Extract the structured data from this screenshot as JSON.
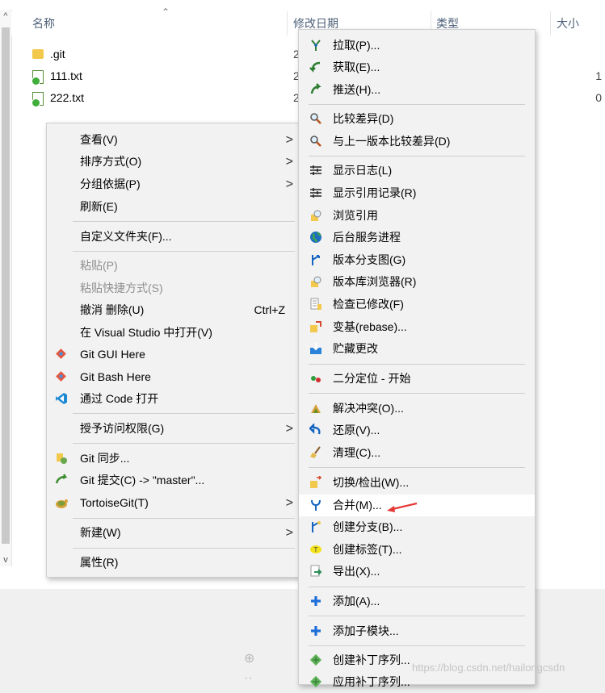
{
  "columns": {
    "name": "名称",
    "date": "修改日期",
    "type": "类型",
    "size": "大小"
  },
  "files": [
    {
      "name": ".git",
      "icon": "folder-icon",
      "date_frag": "2"
    },
    {
      "name": "111.txt",
      "icon": "git-file-icon",
      "date_frag": "2",
      "size_frag": "1"
    },
    {
      "name": "222.txt",
      "icon": "git-file-icon",
      "date_frag": "2",
      "size_frag": "0"
    }
  ],
  "context_menu": {
    "view": "查看(V)",
    "sort": "排序方式(O)",
    "group": "分组依据(P)",
    "refresh": "刷新(E)",
    "customize": "自定义文件夹(F)...",
    "paste": "粘贴(P)",
    "paste_shortcut": "粘贴快捷方式(S)",
    "undo": "撤消 删除(U)",
    "undo_shortcut": "Ctrl+Z",
    "open_vs": "在 Visual Studio 中打开(V)",
    "git_gui": "Git GUI Here",
    "git_bash": "Git Bash Here",
    "open_code": "通过 Code 打开",
    "grant_access": "授予访问权限(G)",
    "git_sync": "Git 同步...",
    "git_commit": "Git 提交(C) -> \"master\"...",
    "tortoisegit": "TortoiseGit(T)",
    "new": "新建(W)",
    "properties": "属性(R)"
  },
  "submenu": {
    "pull": "拉取(P)...",
    "fetch": "获取(E)...",
    "push": "推送(H)...",
    "diff": "比较差异(D)",
    "diff_prev": "与上一版本比较差异(D)",
    "show_log": "显示日志(L)",
    "show_reflog": "显示引用记录(R)",
    "browse_refs": "浏览引用",
    "daemon": "后台服务进程",
    "revision_graph": "版本分支图(G)",
    "repo_browser": "版本库浏览器(R)",
    "check_mods": "检查已修改(F)",
    "rebase": "变基(rebase)...",
    "stash": "贮藏更改",
    "bisect": "二分定位 - 开始",
    "resolve": "解决冲突(O)...",
    "revert": "还原(V)...",
    "cleanup": "清理(C)...",
    "switch": "切换/检出(W)...",
    "merge": "合并(M)...",
    "create_branch": "创建分支(B)...",
    "create_tag": "创建标签(T)...",
    "export": "导出(X)...",
    "add": "添加(A)...",
    "add_submodule": "添加子模块...",
    "create_patch": "创建补丁序列...",
    "apply_patch": "应用补丁序列..."
  },
  "watermark": "https://blog.csdn.net/hailongcsdn",
  "colors": {
    "highlight": "#ffffff",
    "menu_bg": "#f2f2f2",
    "arrow": "#e53935"
  }
}
